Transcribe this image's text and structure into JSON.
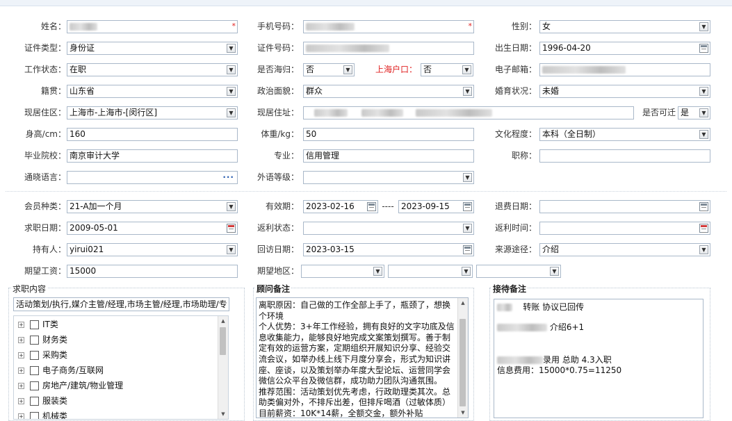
{
  "personal": {
    "name": {
      "label": "姓名：",
      "value": ""
    },
    "phone": {
      "label": "手机号码：",
      "value": ""
    },
    "gender": {
      "label": "性别：",
      "value": "女"
    },
    "id_type": {
      "label": "证件类型：",
      "value": "身份证"
    },
    "id_number": {
      "label": "证件号码：",
      "value": ""
    },
    "birth_date": {
      "label": "出生日期：",
      "value": "1996-04-20"
    },
    "work_status": {
      "label": "工作状态：",
      "value": "在职"
    },
    "returnee": {
      "label": "是否海归：",
      "value": "否"
    },
    "shanghai_hukou": {
      "label": "上海户口：",
      "value": "否"
    },
    "email": {
      "label": "电子邮箱：",
      "value": ""
    },
    "native_place": {
      "label": "籍贯：",
      "value": "山东省"
    },
    "political_status": {
      "label": "政治面貌：",
      "value": "群众"
    },
    "marital_status": {
      "label": "婚育状况：",
      "value": "未婚"
    },
    "current_residence": {
      "label": "现居住区：",
      "value": "上海市-上海市-[闵行区]"
    },
    "current_address": {
      "label": "现居住址：",
      "value": ""
    },
    "relocatable": {
      "label": "是否可迁",
      "value": "是"
    },
    "height": {
      "label": "身高/cm：",
      "value": "160"
    },
    "weight": {
      "label": "体重/kg：",
      "value": "50"
    },
    "education": {
      "label": "文化程度：",
      "value": "本科（全日制）"
    },
    "school": {
      "label": "毕业院校：",
      "value": "南京审计大学"
    },
    "major": {
      "label": "专业：",
      "value": "信用管理"
    },
    "title": {
      "label": "职称：",
      "value": ""
    },
    "languages": {
      "label": "通晓语言：",
      "value": ""
    },
    "foreign_level": {
      "label": "外语等级：",
      "value": ""
    }
  },
  "membership": {
    "member_type": {
      "label": "会员种类：",
      "value": "21-A加一个月"
    },
    "valid_period": {
      "label": "有效期：",
      "start": "2023-02-16",
      "separator": "----",
      "end": "2023-09-15"
    },
    "refund_date": {
      "label": "退费日期：",
      "value": ""
    },
    "job_date": {
      "label": "求职日期：",
      "value": "2009-05-01"
    },
    "rebate_status": {
      "label": "返利状态：",
      "value": ""
    },
    "rebate_time": {
      "label": "返利时间：",
      "value": ""
    },
    "holder": {
      "label": "持有人：",
      "value": "yirui021"
    },
    "visit_date": {
      "label": "回访日期：",
      "value": "2023-03-15"
    },
    "source": {
      "label": "来源途径：",
      "value": "介绍"
    },
    "expected_salary": {
      "label": "期望工资：",
      "value": "15000"
    },
    "expected_area": {
      "label": "期望地区：",
      "value": ""
    }
  },
  "job_content": {
    "title": "求职内容",
    "selected_text": "活动策划/执行,媒介主管/经理,市场主管/经理,市场助理/专",
    "categories": [
      "IT类",
      "财务类",
      "采购类",
      "电子商务/互联网",
      "房地产/建筑/物业管理",
      "服装类",
      "机械类"
    ]
  },
  "consultant_notes": {
    "title": "顾问备注",
    "text": "离职原因：自己做的工作全部上手了，瓶颈了，想换个环境\n个人优势：3+年工作经验，拥有良好的文字功底及信息收集能力，能够良好地完成文案策划撰写。善于制定有效的运营方案，定期组织开展知识分享、经验交流会议，如举办线上线下月度分享会，形式为知识讲座、座谈，以及策划举办年度大型论坛、运营同学会微信公众平台及微信群，成功助力团队沟通氛围。\n推荐范围：活动策划优先考虑，行政助理类其次。总助类偏对外，不排斥出差，但排斥喝酒（过敏体质）\n目前薪资：10K*14薪，全额交金，额外补贴"
  },
  "reception_notes": {
    "title": "接待备注",
    "line1": "转账  协议已回传",
    "line2": "介绍6+1",
    "line3": "录用 总助  4.3入职",
    "line4": "信息费用：15000*0.75=11250"
  },
  "icons": {
    "dropdown": "chevron-down-icon",
    "calendar": "calendar-icon",
    "more": "ellipsis-icon",
    "expand": "plus-icon"
  }
}
